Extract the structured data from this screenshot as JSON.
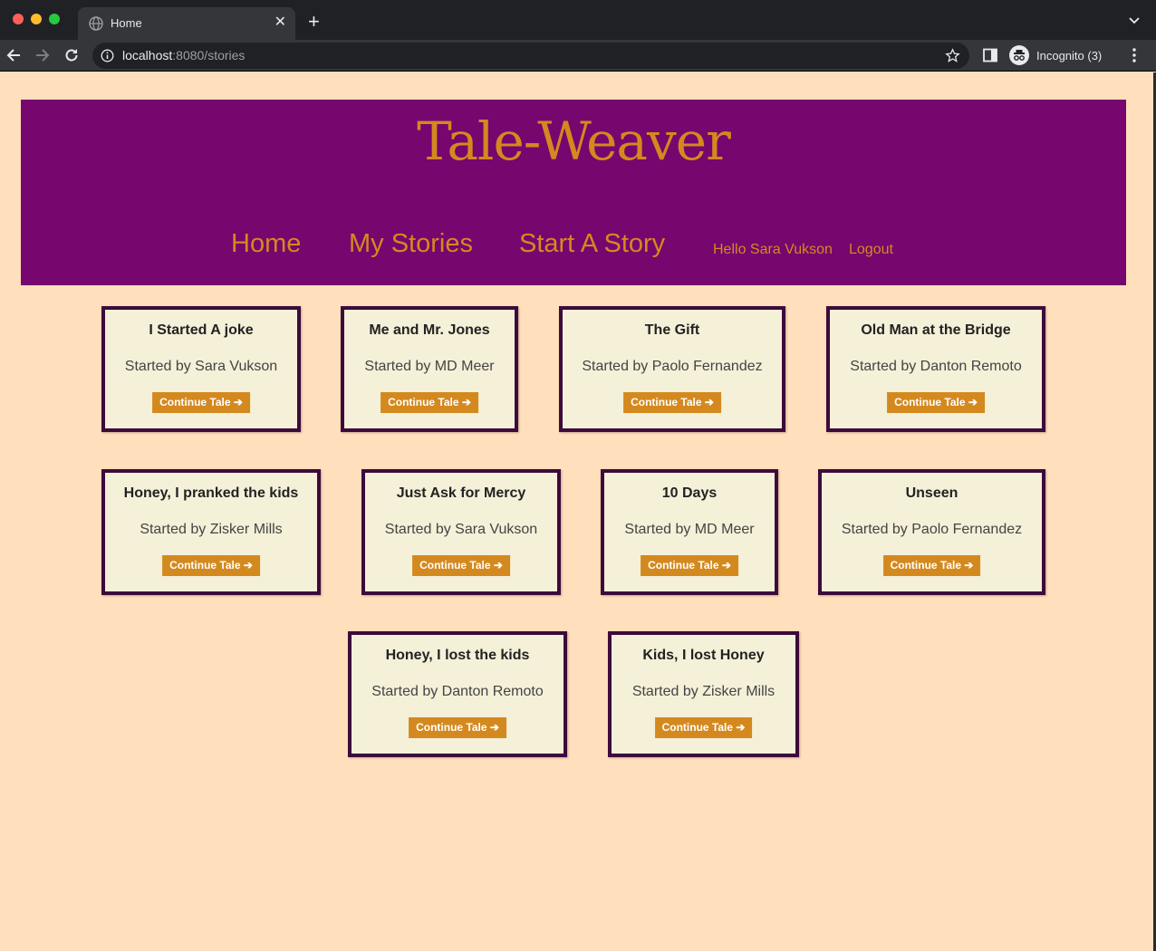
{
  "browser": {
    "tab_title": "Home",
    "url_host": "localhost",
    "url_path": ":8080/stories",
    "incognito_label": "Incognito (3)"
  },
  "site": {
    "logo": "Tale-Weaver",
    "nav": {
      "home": "Home",
      "my_stories": "My Stories",
      "start_story": "Start A Story",
      "greeting": "Hello Sara Vukson",
      "logout": "Logout"
    }
  },
  "stories": [
    {
      "title": "I Started A joke",
      "author": "Started by Sara Vukson",
      "button": "Continue Tale ➔"
    },
    {
      "title": "Me and Mr. Jones",
      "author": "Started by MD Meer",
      "button": "Continue Tale ➔"
    },
    {
      "title": "The Gift",
      "author": "Started by Paolo Fernandez",
      "button": "Continue Tale ➔"
    },
    {
      "title": "Old Man at the Bridge",
      "author": "Started by Danton Remoto",
      "button": "Continue Tale ➔"
    },
    {
      "title": "Honey, I pranked the kids",
      "author": "Started by Zisker Mills",
      "button": "Continue Tale ➔"
    },
    {
      "title": "Just Ask for Mercy",
      "author": "Started by Sara Vukson",
      "button": "Continue Tale ➔"
    },
    {
      "title": "10 Days",
      "author": "Started by MD Meer",
      "button": "Continue Tale ➔"
    },
    {
      "title": "Unseen",
      "author": "Started by Paolo Fernandez",
      "button": "Continue Tale ➔"
    },
    {
      "title": "Honey, I lost the kids",
      "author": "Started by Danton Remoto",
      "button": "Continue Tale ➔"
    },
    {
      "title": "Kids, I lost Honey",
      "author": "Started by Zisker Mills",
      "button": "Continue Tale ➔"
    }
  ],
  "colors": {
    "page_bg": "#ffdfbc",
    "header_bg": "#77066f",
    "accent": "#d4891f",
    "card_bg": "#f5f0d8",
    "card_border": "#3d0a3c"
  }
}
